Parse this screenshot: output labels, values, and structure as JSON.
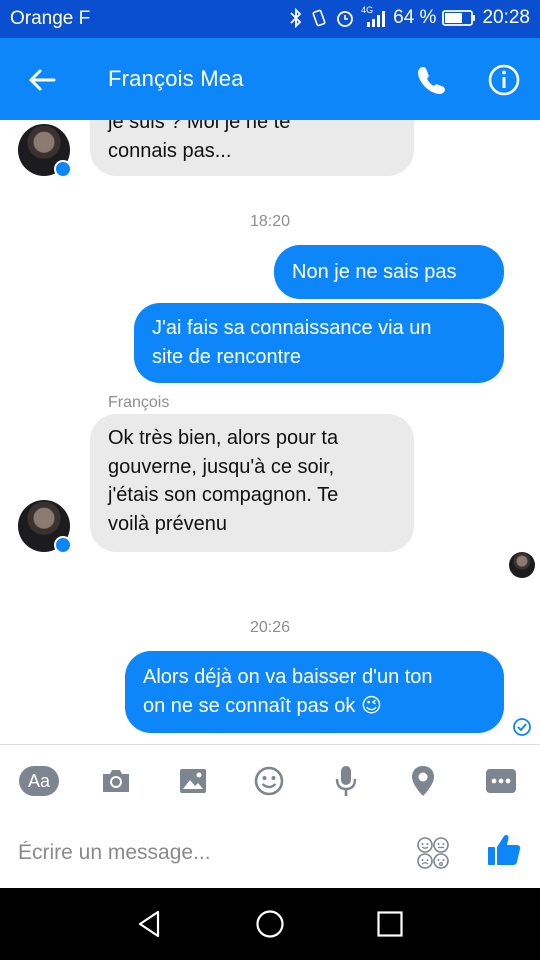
{
  "status_bar": {
    "carrier": "Orange F",
    "network": "4G",
    "battery": "64 %",
    "time": "20:28"
  },
  "header": {
    "contact_name": "François Mea"
  },
  "messages": {
    "m1_line1": "je suis ? Moi je ne te",
    "m1_line2": "connais pas...",
    "ts1": "18:20",
    "m2": "Non je ne sais pas",
    "m3_line1": "J'ai fais sa connaissance via un",
    "m3_line2": "site de rencontre",
    "sender": "François",
    "m4_line1": "Ok très bien, alors pour ta",
    "m4_line2": "gouverne, jusqu'à ce soir,",
    "m4_line3": "j'étais son compagnon. Te",
    "m4_line4": "voilà prévenu",
    "ts2": "20:26",
    "m5_line1": "Alors déjà on va baisser d'un ton",
    "m5_line2": "on ne se connaît pas ok",
    "m5_emoji": "😉"
  },
  "toolbar": {
    "aa_label": "Aa"
  },
  "composer": {
    "placeholder": "Écrire un message..."
  },
  "icons": [
    "back-arrow-icon",
    "phone-icon",
    "info-icon",
    "camera-icon",
    "gallery-icon",
    "emoji-icon",
    "microphone-icon",
    "location-icon",
    "more-icon",
    "stickers-icon",
    "like-icon",
    "nav-back-icon",
    "nav-home-icon",
    "nav-recents-icon"
  ],
  "colors": {
    "status_bar": "#0a4fd0",
    "header": "#0c86f9",
    "outgoing_bubble": "#0c86f9",
    "incoming_bubble": "#eaeaea",
    "toolbar_icons": "#7d8590"
  }
}
